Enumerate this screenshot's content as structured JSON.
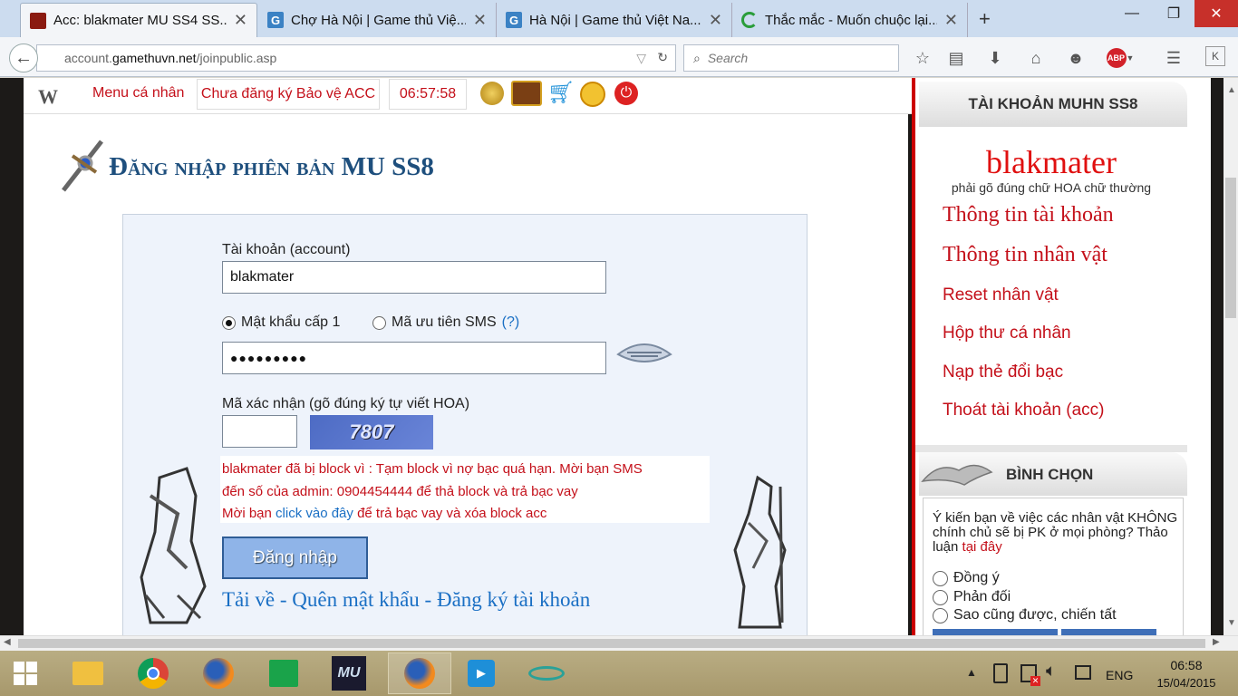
{
  "browser": {
    "tabs": [
      {
        "title": "Acc: blakmater MU SS4 SS...",
        "favicon": "mu-favicon",
        "color": "#8a1a10",
        "active": true
      },
      {
        "title": "Chợ Hà Nội | Game thủ Việ...",
        "favicon": "g-favicon",
        "color": "#3b82c4",
        "active": false
      },
      {
        "title": "Hà Nội | Game thủ Việt Na...",
        "favicon": "g-favicon",
        "color": "#3b82c4",
        "active": false
      },
      {
        "title": "Thắc mắc - Muốn chuộc lại...",
        "favicon": "loading-favicon",
        "color": "#2a9d3a",
        "active": false
      }
    ],
    "url_prefix": "account.",
    "url_domain": "gamethuvn.net",
    "url_path": "/joinpublic.asp",
    "search_placeholder": "Search",
    "abp_label": "ABP"
  },
  "topstrip": {
    "menu": "Menu cá nhân",
    "protect": "Chưa đăng ký Bảo vệ ACC",
    "clock": "06:57:58"
  },
  "main": {
    "heading": "Đăng nhập phiên bản MU SS8",
    "account_label": "Tài khoản (account)",
    "account_value": "blakmater",
    "radio_password": "Mật khẩu cấp 1",
    "radio_sms": "Mã ưu tiên SMS",
    "sms_help": "(?)",
    "password_value": "●●●●●●●●●",
    "captcha_label": "Mã xác nhận (gõ đúng ký tự viết HOA)",
    "captcha_text": "7807",
    "error_line1": "blakmater đã bị block vì : Tạm block vì nợ bạc quá hạn. Mời bạn SMS",
    "error_line2": "đến số của admin: 0904454444 để thả block và trả bạc vay",
    "error_line3_pre": "Mời bạn ",
    "error_line3_link": "click vào đây",
    "error_line3_post": " để trả bạc vay và xóa block acc",
    "login_button": "Đăng nhập",
    "link_download": "Tải về",
    "sep": "-",
    "link_forgot": "Quên mật khẩu",
    "link_register": "Đăng ký tài khoản"
  },
  "sidebar": {
    "header": "TÀI KHOẢN MUHN SS8",
    "username": "blakmater",
    "case_note": "phải gõ đúng chữ HOA chữ thường",
    "links_serif": [
      "Thông tin tài khoản",
      "Thông tin nhân vật"
    ],
    "links_sans": [
      "Reset nhân vật",
      "Hộp thư cá nhân",
      "Nạp thẻ đổi bạc",
      "Thoát tài khoản (acc)"
    ],
    "poll_header": "BÌNH CHỌN",
    "poll_question": "Ý kiến bạn về việc các nhân vật KHÔNG chính chủ sẽ bị PK ở mọi phòng? Thảo luận ",
    "poll_link": "tại đây",
    "poll_options": [
      "Đồng ý",
      "Phản đối",
      "Sao cũng được, chiến tất"
    ]
  },
  "taskbar": {
    "lang": "ENG",
    "time": "06:58",
    "date": "15/04/2015"
  },
  "colors": {
    "accent_red": "#c4101a",
    "link_blue": "#1a6fc4",
    "heading_blue": "#1e4f7d"
  }
}
